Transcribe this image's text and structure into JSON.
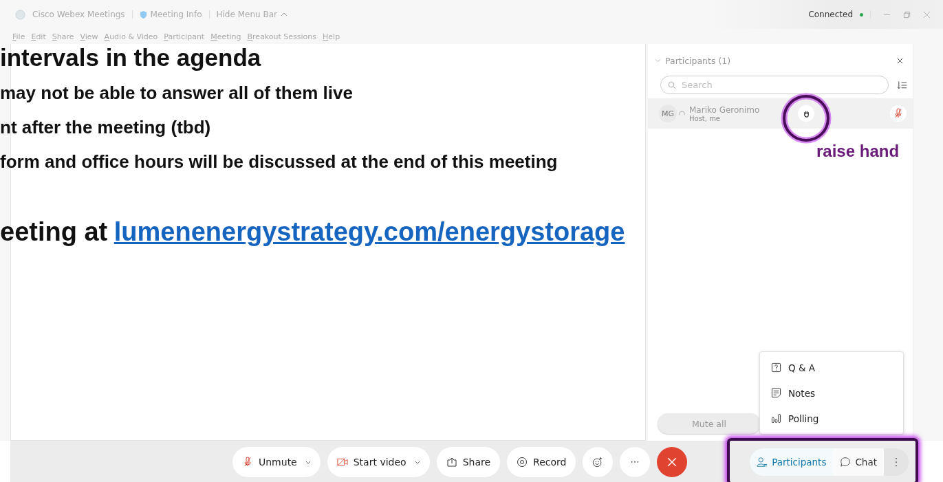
{
  "title_bar": {
    "app": "Cisco Webex Meetings",
    "meeting_info": "Meeting Info",
    "hide_menu": "Hide Menu Bar",
    "status": "Connected",
    "connected": true
  },
  "menu": [
    "File",
    "Edit",
    "Share",
    "View",
    "Audio & Video",
    "Participant",
    "Meeting",
    "Breakout Sessions",
    "Help"
  ],
  "slide": {
    "heading": "intervals in the agenda",
    "lines": [
      "may not be able to answer all of them live",
      "nt after the meeting (tbd)",
      "form and office hours will be discussed at the end of this meeting"
    ],
    "footer": "eeting at",
    "link": "lumenenergystrategy.com/energystorage"
  },
  "participants_panel": {
    "title": "Participants (1)",
    "search": {
      "placeholder": "Search"
    },
    "participants": [
      {
        "initials": "MG",
        "name": "Mariko Geronimo",
        "role": "Host, me",
        "hand_raised": true,
        "muted": true
      }
    ],
    "mute_all": "Mute all"
  },
  "more_menu": [
    {
      "kind": "qa",
      "label": "Q & A"
    },
    {
      "kind": "notes",
      "label": "Notes"
    },
    {
      "kind": "polling",
      "label": "Polling"
    }
  ],
  "toolbar": [
    {
      "kind": "unmute",
      "label": "Unmute",
      "dropdown": true
    },
    {
      "kind": "video",
      "label": "Start video",
      "dropdown": true
    },
    {
      "kind": "share",
      "label": "Share",
      "dropdown": false
    },
    {
      "kind": "record",
      "label": "Record",
      "dropdown": false
    },
    {
      "kind": "reactions"
    },
    {
      "kind": "more"
    },
    {
      "kind": "end"
    }
  ],
  "panel_tabs": [
    {
      "kind": "participants",
      "label": "Participants",
      "selected": true
    },
    {
      "kind": "chat",
      "label": "Chat",
      "selected": false
    }
  ],
  "annotation": {
    "label": "raise hand"
  }
}
